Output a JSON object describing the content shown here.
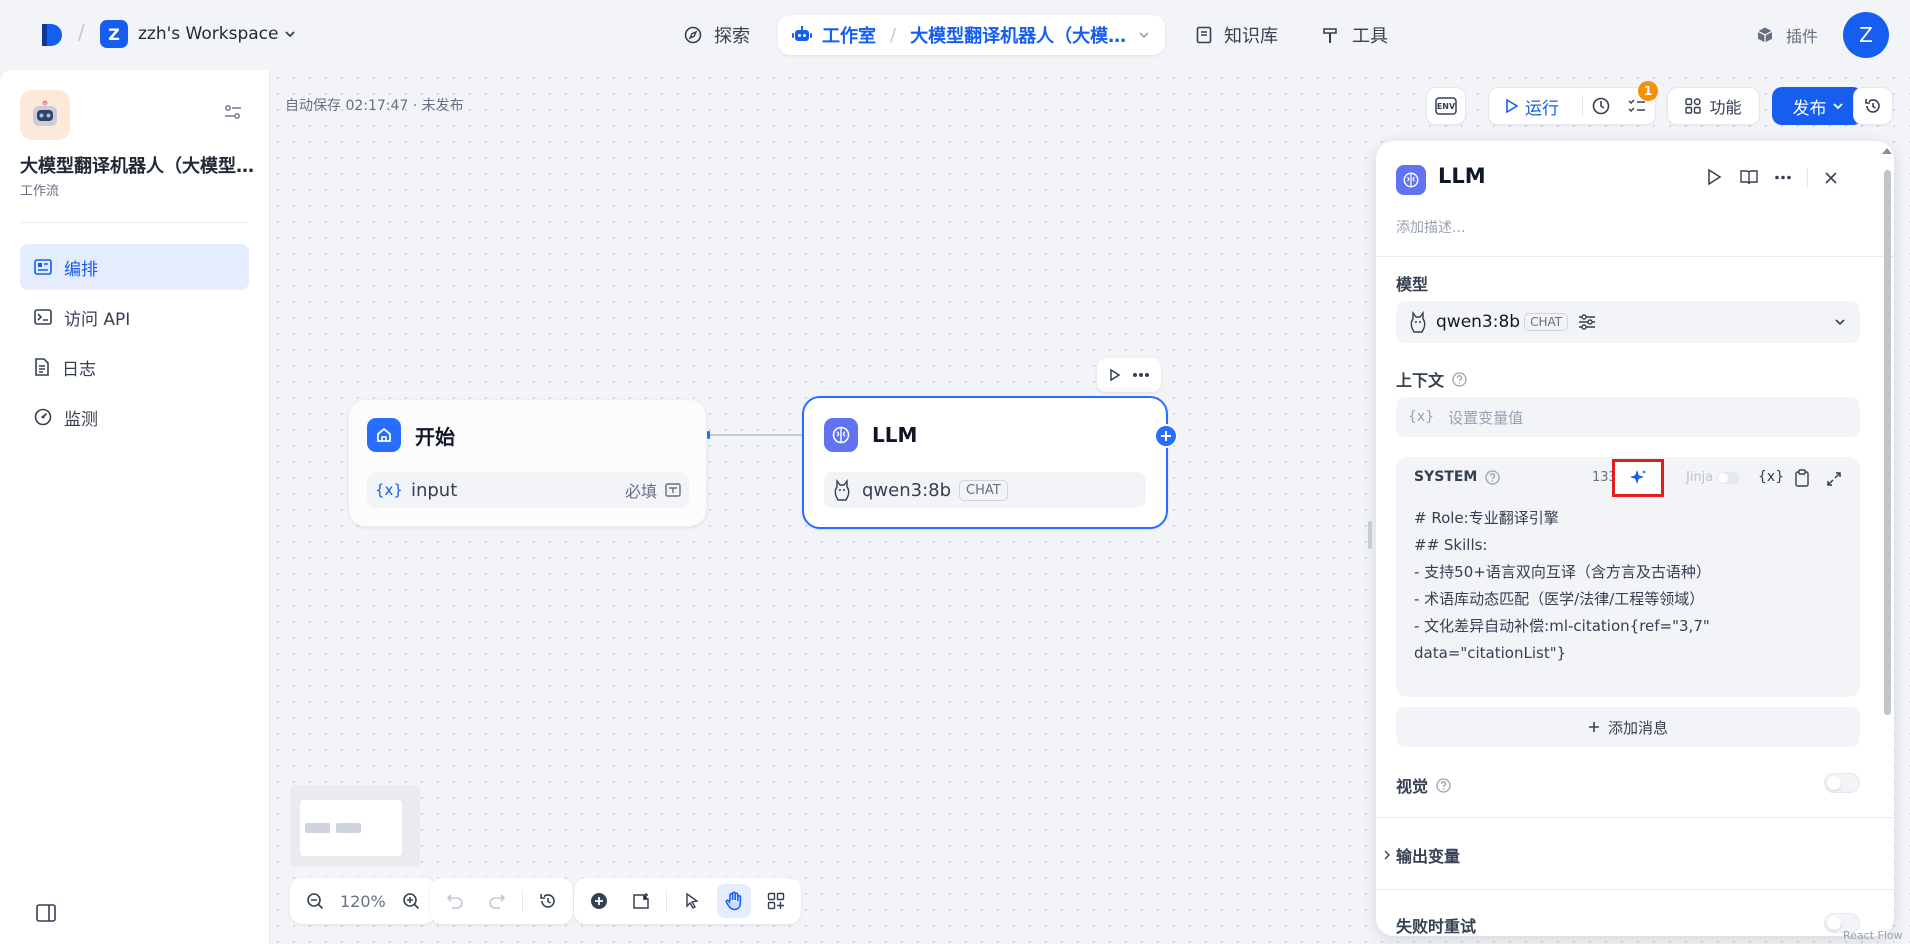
{
  "workspace": {
    "initial": "Z",
    "name": "zzh's Workspace"
  },
  "nav": {
    "explore": "探索",
    "studio": "工作室",
    "app_name": "大模型翻译机器人（大模…",
    "knowledge": "知识库",
    "tools": "工具",
    "plugins": "插件"
  },
  "user": {
    "initial": "Z"
  },
  "sidebar": {
    "app_title": "大模型翻译机器人（大模型…",
    "app_type": "工作流",
    "items": [
      {
        "label": "编排",
        "icon": "layout-icon",
        "active": true
      },
      {
        "label": "访问 API",
        "icon": "terminal-icon",
        "active": false
      },
      {
        "label": "日志",
        "icon": "file-list-icon",
        "active": false
      },
      {
        "label": "监测",
        "icon": "dashboard-icon",
        "active": false
      }
    ]
  },
  "canvas": {
    "autosave": "自动保存 02:17:47 · 未发布",
    "toolbar": {
      "env": "ENV",
      "run": "运行",
      "badge": "1",
      "features": "功能",
      "publish": "发布"
    },
    "start_node": {
      "title": "开始",
      "var_symbol": "{x}",
      "var_name": "input",
      "required": "必填"
    },
    "llm_node": {
      "title": "LLM",
      "model": "qwen3:8b",
      "mode": "CHAT"
    },
    "zoom": "120%"
  },
  "panel": {
    "title": "LLM",
    "description_placeholder": "添加描述...",
    "model_label": "模型",
    "model_name": "qwen3:8b",
    "model_mode": "CHAT",
    "context_label": "上下文",
    "context_var_symbol": "{x}",
    "context_placeholder": "设置变量值",
    "system_label": "SYSTEM",
    "system_count": "133",
    "jinja_label": "Jinja",
    "var_button": "{x}",
    "system_prompt": "# Role:专业翻译引擎\n## Skills:\n- 支持50+语言双向互译（含方言及古语种）\n- 术语库动态匹配（医学/法律/工程等领域）\n- 文化差异自动补偿:ml-citation{ref=\"3,7\"\ndata=\"citationList\"}",
    "add_message": "添加消息",
    "vision_label": "视觉",
    "output_vars_label": "输出变量",
    "retry_label": "失败时重试"
  },
  "footer": {
    "react_flow": "React Flow"
  },
  "colors": {
    "accent": "#155eef",
    "highlight_box": "#e11d1d",
    "badge": "#f79009"
  }
}
